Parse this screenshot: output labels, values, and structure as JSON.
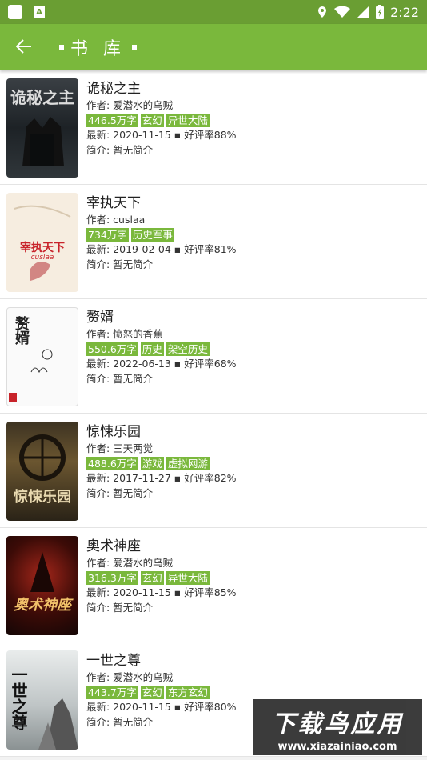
{
  "status_bar": {
    "time": "2:22"
  },
  "app_bar": {
    "title": "书 库"
  },
  "books": [
    {
      "name": "诡秘之主",
      "author": "作者: 爱潜水的乌贼",
      "tags": [
        "446.5万字",
        "玄幻",
        "异世大陆"
      ],
      "latest": "最新: 2020-11-15 ▪ 好评率88%",
      "intro": "简介: 暂无简介",
      "cover_text": "诡秘之主"
    },
    {
      "name": "宰执天下",
      "author": "作者: cuslaa",
      "tags": [
        "734万字",
        "历史军事"
      ],
      "latest": "最新: 2019-02-04 ▪ 好评率81%",
      "intro": "简介: 暂无简介",
      "cover_text": "宰执天下",
      "cover_sub": "cuslaa"
    },
    {
      "name": "赘婿",
      "author": "作者: 愤怒的香蕉",
      "tags": [
        "550.6万字",
        "历史",
        "架空历史"
      ],
      "latest": "最新: 2022-06-13 ▪ 好评率68%",
      "intro": "简介: 暂无简介",
      "cover_text": "赘婿"
    },
    {
      "name": "惊悚乐园",
      "author": "作者: 三天两觉",
      "tags": [
        "488.6万字",
        "游戏",
        "虚拟网游"
      ],
      "latest": "最新: 2017-11-27 ▪ 好评率82%",
      "intro": "简介: 暂无简介",
      "cover_text": "惊悚乐园"
    },
    {
      "name": "奥术神座",
      "author": "作者: 爱潜水的乌贼",
      "tags": [
        "316.3万字",
        "玄幻",
        "异世大陆"
      ],
      "latest": "最新: 2020-11-15 ▪ 好评率85%",
      "intro": "简介: 暂无简介",
      "cover_text": "奥术神座"
    },
    {
      "name": "一世之尊",
      "author": "作者: 爱潜水的乌贼",
      "tags": [
        "443.7万字",
        "玄幻",
        "东方玄幻"
      ],
      "latest": "最新: 2020-11-15 ▪ 好评率80%",
      "intro": "简介: 暂无简介",
      "cover_text": "一世之尊"
    }
  ],
  "watermark": {
    "title": "下载鸟应用",
    "url": "www.xiazainiao.com"
  },
  "colors": {
    "accent": "#7ab83c",
    "status": "#6a9e33"
  }
}
